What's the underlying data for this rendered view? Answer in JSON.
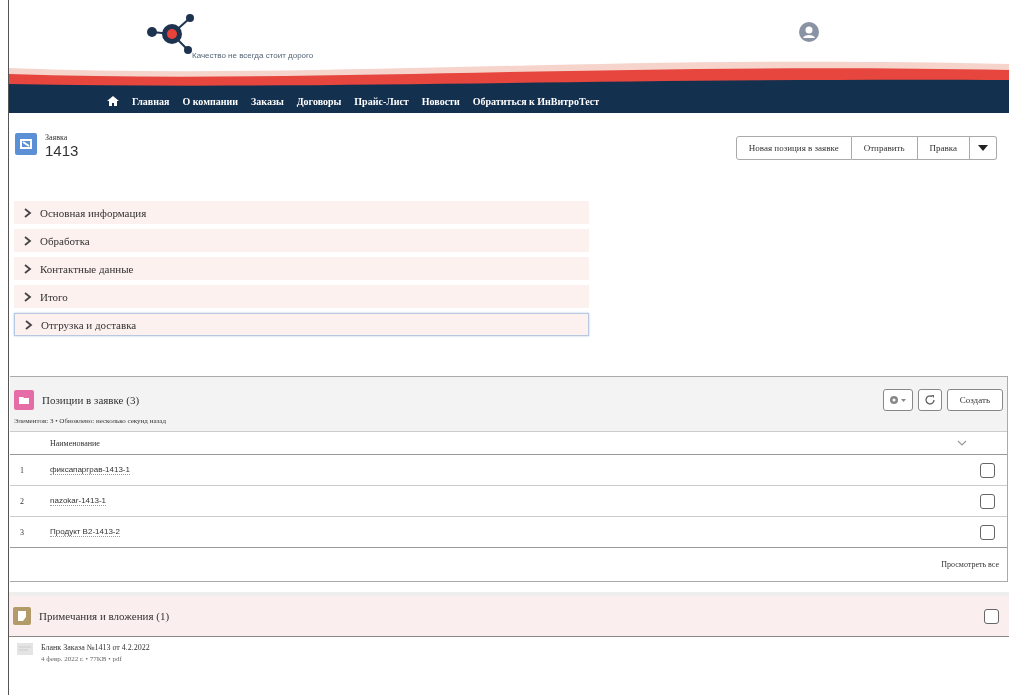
{
  "header": {
    "tagline": "Качество не всегда стоит дорого"
  },
  "nav": [
    "Главная",
    "О компании",
    "Заказы",
    "Договоры",
    "Прайс-Лист",
    "Новости",
    "Обратиться к ИнВитроТест"
  ],
  "record": {
    "type": "Заявка",
    "name": "1413"
  },
  "actions": [
    "Новая позиция в заявке",
    "Отправить",
    "Правка"
  ],
  "sections": [
    {
      "label": "Основная информация",
      "expanded": false,
      "focused": false
    },
    {
      "label": "Обработка",
      "expanded": false,
      "focused": false
    },
    {
      "label": "Контактные данные",
      "expanded": false,
      "focused": false
    },
    {
      "label": "Итого",
      "expanded": false,
      "focused": false
    },
    {
      "label": "Отгрузка и доставка",
      "expanded": false,
      "focused": true
    }
  ],
  "items": {
    "title": "Позиции в заявке (3)",
    "subtitle": "Элементов: 3 • Обновлено: несколько секунд назад",
    "create": "Создать",
    "column": "Наименование",
    "rows": [
      {
        "num": "1",
        "name": "фиксапарграв-1413-1",
        "checked": false
      },
      {
        "num": "2",
        "name": "nazokar-1413-1",
        "checked": false
      },
      {
        "num": "3",
        "name": "Продукт B2-1413-2",
        "checked": false
      }
    ],
    "view_all": "Просмотреть все"
  },
  "notes": {
    "title": "Примечания и вложения (1)",
    "checked": false,
    "files": [
      {
        "name": "Бланк Заказа №1413 от 4.2.2022",
        "meta": "4 февр. 2022 г. • 77KB • pdf"
      }
    ]
  }
}
